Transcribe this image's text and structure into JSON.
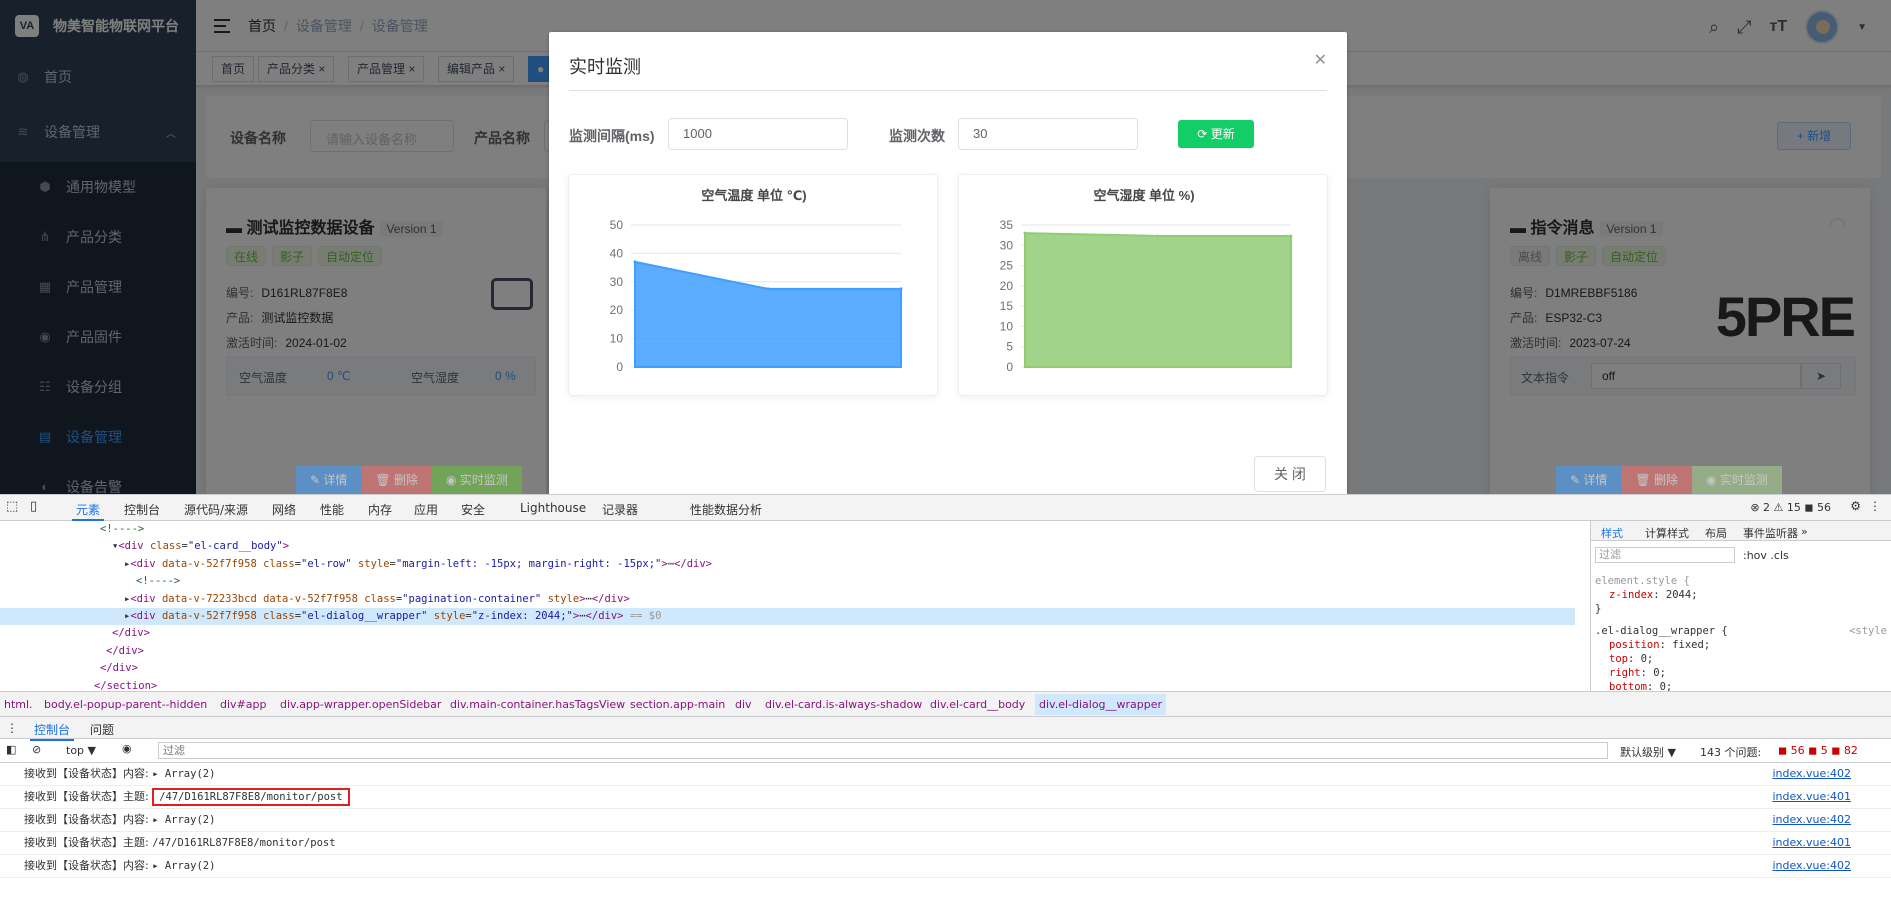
{
  "app": {
    "logo_text": "物美智能物联网平台",
    "logo_mark": "VA",
    "sidebar": [
      {
        "label": "首页",
        "icon": "dashboard-icon",
        "glyph": "◍"
      },
      {
        "label": "设备管理",
        "icon": "layers-icon",
        "glyph": "≋"
      },
      {
        "label": "通用物模型",
        "icon": "cube-icon",
        "glyph": "⬢"
      },
      {
        "label": "产品分类",
        "icon": "tree-icon",
        "glyph": "⋔"
      },
      {
        "label": "产品管理",
        "icon": "grid-icon",
        "glyph": "▦"
      },
      {
        "label": "产品固件",
        "icon": "firmware-icon",
        "glyph": "◉"
      },
      {
        "label": "设备分组",
        "icon": "group-icon",
        "glyph": "☷"
      },
      {
        "label": "设备管理",
        "icon": "device-icon",
        "glyph": "▤"
      },
      {
        "label": "设备告警",
        "icon": "alert-icon",
        "glyph": "◐"
      }
    ],
    "breadcrumb": [
      "首页",
      "设备管理",
      "设备管理"
    ],
    "tags": [
      "首页",
      "产品分类",
      "产品管理",
      "编辑产品"
    ],
    "search": {
      "name_label": "设备名称",
      "name_placeholder": "请输入设备名称",
      "product_label": "产品名称",
      "new_button": "+ 新增"
    },
    "cards": [
      {
        "title": "测试监控数据设备",
        "version": "Version 1",
        "badges": [
          "在线",
          "影子",
          "自动定位"
        ],
        "serial_label": "编号:",
        "serial": "D161RL87F8E8",
        "product_label": "产品:",
        "product": "测试监控数据",
        "time_label": "激活时间:",
        "time": "2024-01-02",
        "metric1_label": "空气温度",
        "metric1_value": "0 ℃",
        "metric2_label": "空气湿度",
        "metric2_value": "0 %",
        "btn_detail": "详情",
        "btn_delete": "删除",
        "btn_monitor": "实时监测"
      },
      {
        "title": "指令消息",
        "version": "Version 1",
        "badges": [
          "离线",
          "影子",
          "自动定位"
        ],
        "serial_label": "编号:",
        "serial": "D1MREBBF5186",
        "product_label": "产品:",
        "product": "ESP32-C3",
        "time_label": "激活时间:",
        "time": "2023-07-24",
        "cmd_label": "文本指令",
        "cmd_value": "off",
        "brand_text": "5PRE",
        "btn_detail": "详情",
        "btn_delete": "删除",
        "btn_monitor": "实时监测"
      }
    ],
    "middle_btn": "实时监测"
  },
  "dialog": {
    "title": "实时监测",
    "interval_label": "监测间隔(ms)",
    "interval_value": "1000",
    "count_label": "监测次数",
    "count_value": "30",
    "refresh_label": "更新",
    "close_label": "关 闭"
  },
  "chart_data": [
    {
      "type": "area",
      "title": "空气温度 单位 ℃)",
      "x": [
        0,
        1,
        2
      ],
      "series": [
        {
          "values": [
            37,
            27.5,
            27.5
          ],
          "color": "#409eff"
        }
      ],
      "ylim": [
        0,
        50
      ],
      "yticks": [
        0,
        10,
        20,
        30,
        40,
        50
      ],
      "grid": true
    },
    {
      "type": "area",
      "title": "空气湿度 单位 %)",
      "x": [
        0,
        1,
        2
      ],
      "series": [
        {
          "values": [
            33,
            32.3,
            32.3
          ],
          "color": "#91cc75"
        }
      ],
      "ylim": [
        0,
        35
      ],
      "yticks": [
        0,
        5,
        10,
        15,
        20,
        25,
        30,
        35
      ],
      "grid": true
    }
  ],
  "devtools": {
    "tabs": [
      "元素",
      "控制台",
      "源代码/来源",
      "网络",
      "性能",
      "内存",
      "应用",
      "安全",
      "Lighthouse",
      "记录器",
      "性能数据分析"
    ],
    "counts": "⊗ 2  ⚠ 15  ◼ 56",
    "tree": [
      {
        "indent": 0,
        "html": "<span class='cm'>&lt;!----&gt;</span>"
      },
      {
        "indent": 1,
        "html": "▾<span class='tg'>&lt;div </span><span class='an'>class</span>=<span class='av'>\"el-card__body\"</span><span class='tg'>&gt;</span>"
      },
      {
        "indent": 2,
        "html": "▸<span class='tg'>&lt;div </span><span class='an'>data-v-52f7f958 class</span>=<span class='av'>\"el-row\"</span> <span class='an'>style</span>=<span class='av'>\"margin-left: -15px; margin-right: -15px;\"</span><span class='tg'>&gt;</span>⋯<span class='tg'>&lt;/div&gt;</span>"
      },
      {
        "indent": 3,
        "html": "<span class='cm'>&lt;!----&gt;</span>"
      },
      {
        "indent": 2,
        "html": "▸<span class='tg'>&lt;div </span><span class='an'>data-v-72233bcd data-v-52f7f958 class</span>=<span class='av'>\"pagination-container\"</span> <span class='an'>style</span><span class='tg'>&gt;</span>⋯<span class='tg'>&lt;/div&gt;</span>"
      },
      {
        "indent": 2,
        "html": "▸<span class='tg'>&lt;div </span><span class='an'>data-v-52f7f958 class</span>=<span class='av'>\"el-dialog__wrapper\"</span> <span class='an'>style</span>=<span class='av'>\"z-index: 2044;\"</span><span class='tg'>&gt;</span>⋯<span class='tg'>&lt;/div&gt;</span> <span class='gr'>== $0</span>"
      },
      {
        "indent": 1,
        "html": "<span class='tg'>&lt;/div&gt;</span>"
      },
      {
        "indent": 0.5,
        "html": "<span class='tg'>&lt;/div&gt;</span>"
      },
      {
        "indent": 0,
        "html": "<span class='tg'>&lt;/div&gt;</span>"
      },
      {
        "indent": -0.5,
        "html": "<span class='tg'>&lt;/section&gt;</span>"
      }
    ],
    "style_tabs": [
      "样式",
      "计算样式",
      "布局",
      "事件监听器",
      "»"
    ],
    "filter": "过滤",
    "hov": ":hov  .cls",
    "breadcrumbs": [
      "html.",
      "body.el-popup-parent--hidden",
      "div#app",
      "div.app-wrapper.openSidebar",
      "div.main-container.hasTagsView",
      "section.app-main",
      "div",
      "div.el-card.is-always-shadow",
      "div.el-card__body",
      "div.el-dialog__wrapper"
    ],
    "console_tabs": [
      "控制台",
      "问题"
    ],
    "console_top": "top ▼",
    "console_filter": "过滤",
    "level": "默认级别 ▼",
    "issues": "143 个问题:",
    "issue_counts": "◼ 56  ◼ 5  ◼ 82",
    "logs": [
      {
        "text": "接收到【设备状态】内容:",
        "val": "▸ Array(2)",
        "src": "index.vue:402",
        "hl": false
      },
      {
        "text": "接收到【设备状态】主题:",
        "val": "/47/D161RL87F8E8/monitor/post",
        "src": "index.vue:401",
        "hl": true
      },
      {
        "text": "接收到【设备状态】内容:",
        "val": "▸ Array(2)",
        "src": "index.vue:402",
        "hl": false
      },
      {
        "text": "接收到【设备状态】主题:",
        "val": "/47/D161RL87F8E8/monitor/post",
        "src": "index.vue:401",
        "hl": false
      },
      {
        "text": "接收到【设备状态】内容:",
        "val": "▸ Array(2)",
        "src": "index.vue:402",
        "hl": false
      }
    ]
  }
}
